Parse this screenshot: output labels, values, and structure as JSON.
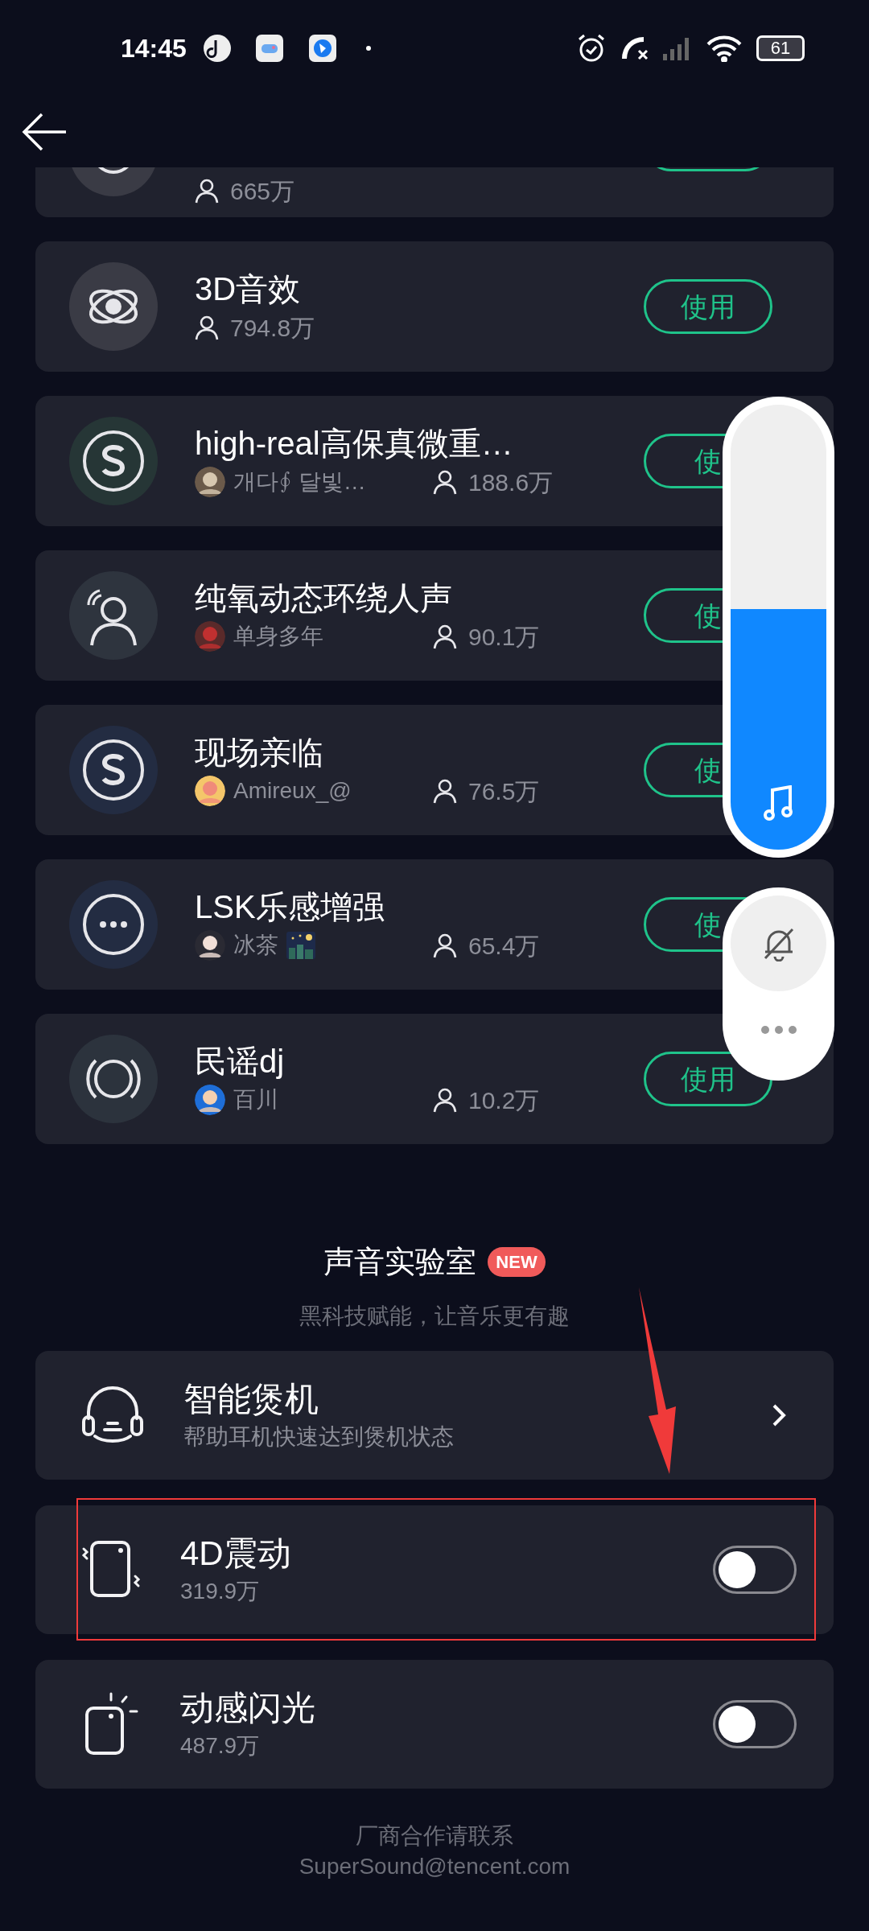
{
  "status_bar": {
    "time": "14:45",
    "battery": "61"
  },
  "effects": [
    {
      "count": "665万"
    },
    {
      "title": "3D音效",
      "count": "794.8万",
      "button": "使用"
    },
    {
      "title": "high-real高保真微重…",
      "author": "개다∮ 달빛…",
      "count": "188.6万",
      "button": "使"
    },
    {
      "title": "纯氧动态环绕人声",
      "author": "单身多年",
      "count": "90.1万",
      "button": "使"
    },
    {
      "title": "现场亲临",
      "author": "Amireux_@",
      "count": "76.5万",
      "button": "使"
    },
    {
      "title": "LSK乐感增强",
      "author": "冰茶",
      "count": "65.4万",
      "button": "使"
    },
    {
      "title": "民谣dj",
      "author": "百川",
      "count": "10.2万",
      "button": "使用"
    }
  ],
  "lab": {
    "title": "声音实验室",
    "badge": "NEW",
    "subtitle": "黑科技赋能，让音乐更有趣",
    "items": [
      {
        "kind": "link",
        "title": "智能煲机",
        "subtitle": "帮助耳机快速达到煲机状态"
      },
      {
        "kind": "toggle",
        "title": "4D震动",
        "subtitle": "319.9万",
        "on": false
      },
      {
        "kind": "toggle",
        "title": "动感闪光",
        "subtitle": "487.9万",
        "on": false
      }
    ]
  },
  "footer": {
    "line1": "厂商合作请联系",
    "line2": "SuperSound@tencent.com"
  },
  "volume_panel": {
    "level": 0.54
  }
}
